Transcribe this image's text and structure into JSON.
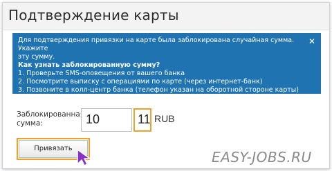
{
  "page": {
    "title": "Подтверждение карты"
  },
  "info": {
    "line1": "Для подтверждения привязки на карте была заблокирована случайная сумма. Укажите",
    "line2": "эту сумму.",
    "line3": "Как узнать заблокированную сумму?",
    "line4": "1. Проверьте SMS-оповещения от вашего банка",
    "line5": "2. Посмотрите выписку с операциями по карте (через интернет-банк)",
    "line6": "3. Позвоните в колл-центр банка (телефон указан на оборотной стороне карты)",
    "close_icon": "close-icon",
    "background_color": "#1e73b0"
  },
  "form": {
    "label_line1": "Заблокированная",
    "label_line2": "сумма:",
    "amount_value": "10",
    "kopecks_value": "11",
    "currency": "RUB"
  },
  "actions": {
    "bind_label": "Привязать",
    "highlight_color": "#f0a128"
  },
  "watermark": "EASY-JOBS.RU"
}
